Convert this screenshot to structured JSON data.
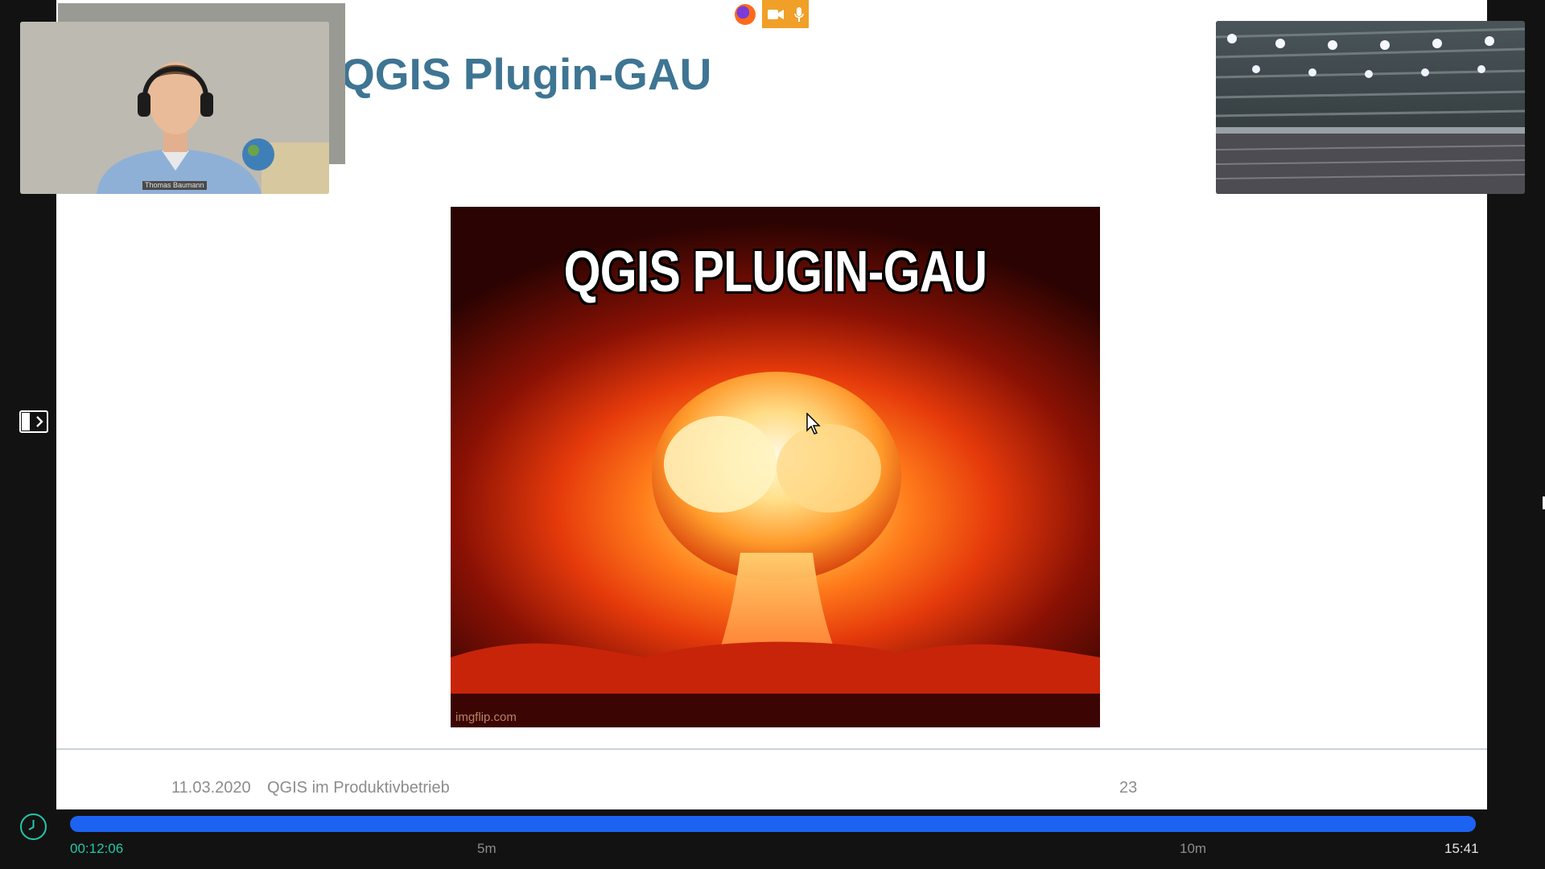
{
  "slide": {
    "title": "QGIS Plugin-GAU",
    "meme": {
      "caption": "QGIS PLUGIN-GAU",
      "watermark": "imgflip.com"
    },
    "footer": {
      "date": "11.03.2020",
      "title": "QGIS im Produktivbetrieb",
      "page": "23"
    }
  },
  "participants": {
    "speaker_name": "Thomas Baumann"
  },
  "indicators": {
    "icons": [
      "browser-icon",
      "camera-icon",
      "microphone-icon"
    ],
    "recording_color": "#f0a028"
  },
  "playback": {
    "current_time": "00:12:06",
    "marker_5m": "5m",
    "marker_10m": "10m",
    "total_time": "15:41",
    "progress_fraction": 1.0,
    "progress_color": "#1d63f2",
    "accent_color": "#22c8a8"
  }
}
